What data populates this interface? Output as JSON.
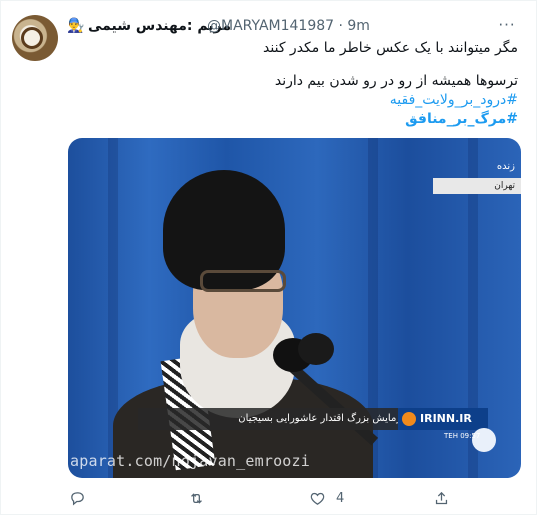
{
  "tweet": {
    "author_emoji": "👨‍🔧",
    "display_name": "مریم :مهندس شیمی",
    "handle_time": "@MARYAM141987 · 9m",
    "text_lines": [
      "مگر میتوانند  با یک عکس خاطر ما مکدر کنند",
      "ترسوها  همیشه از رو در رو شدن بیم دارند"
    ],
    "hashtags": [
      "#درود_بر_ولایت_فقیه",
      "#مرگ_بر_منافق"
    ]
  },
  "media": {
    "live_label": "زنده",
    "city_label": "تهران",
    "ticker_text": "رزمایش بزرگ اقتدار عاشورایی بسیجیان",
    "channel_name": "IRINN.IR",
    "clock": "TEH 09:57",
    "watermark": "aparat.com/nojavan_emroozi"
  },
  "actions": {
    "reply_icon": "reply-icon",
    "retweet_icon": "retweet-icon",
    "like_icon": "heart-icon",
    "like_count": "4",
    "share_icon": "share-icon"
  }
}
